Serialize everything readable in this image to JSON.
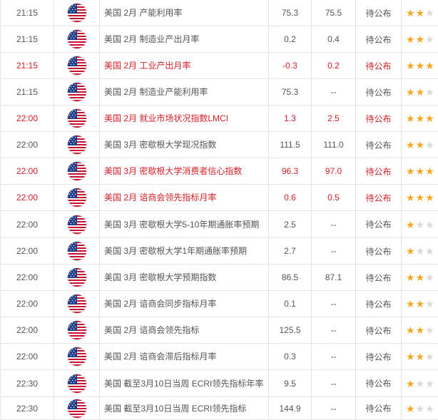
{
  "rows": [
    {
      "time": "21:15",
      "title": "美国 2月 产能利用率",
      "prev": "75.3",
      "forecast": "75.5",
      "actual": "待公布",
      "stars": 2,
      "highlight": false,
      "height": 37
    },
    {
      "time": "21:15",
      "title": "美国 2月 制造业产出月率",
      "prev": "0.2",
      "forecast": "0.4",
      "actual": "待公布",
      "stars": 2,
      "highlight": false,
      "height": 37
    },
    {
      "time": "21:15",
      "title": "美国 2月 工业产出月率",
      "prev": "-0.3",
      "forecast": "0.2",
      "actual": "待公布",
      "stars": 3,
      "highlight": true,
      "height": 37
    },
    {
      "time": "21:15",
      "title": "美国 2月 制造业产能利用率",
      "prev": "75.3",
      "forecast": "--",
      "actual": "待公布",
      "stars": 2,
      "highlight": false,
      "height": 37
    },
    {
      "time": "22:00",
      "title": "美国 2月 就业市场状况指数LMCI",
      "prev": "1.3",
      "forecast": "2.5",
      "actual": "待公布",
      "stars": 3,
      "highlight": true,
      "height": 37
    },
    {
      "time": "22:00",
      "title": "美国 3月 密歇根大学现况指数",
      "prev": "111.5",
      "forecast": "111.0",
      "actual": "待公布",
      "stars": 2,
      "highlight": false,
      "height": 37
    },
    {
      "time": "22:00",
      "title": "美国 3月 密歇根大学消费者信心指数",
      "prev": "96.3",
      "forecast": "97.0",
      "actual": "待公布",
      "stars": 3,
      "highlight": true,
      "height": 37
    },
    {
      "time": "22:00",
      "title": "美国 2月 谘商会领先指标月率",
      "prev": "0.6",
      "forecast": "0.5",
      "actual": "待公布",
      "stars": 3,
      "highlight": true,
      "height": 37
    },
    {
      "time": "22:00",
      "title": "美国 3月 密歇根大学5-10年期通胀率预期",
      "prev": "2.5",
      "forecast": "--",
      "actual": "待公布",
      "stars": 1,
      "highlight": false,
      "height": 38
    },
    {
      "time": "22:00",
      "title": "美国 3月 密歇根大学1年期通胀率预期",
      "prev": "2.7",
      "forecast": "--",
      "actual": "待公布",
      "stars": 1,
      "highlight": false,
      "height": 37
    },
    {
      "time": "22:00",
      "title": "美国 3月 密歇根大学预期指数",
      "prev": "86.5",
      "forecast": "87.1",
      "actual": "待公布",
      "stars": 2,
      "highlight": false,
      "height": 37
    },
    {
      "time": "22:00",
      "title": "美国 2月 谘商会同步指标月率",
      "prev": "0.1",
      "forecast": "--",
      "actual": "待公布",
      "stars": 2,
      "highlight": false,
      "height": 37
    },
    {
      "time": "22:00",
      "title": "美国 2月 谘商会领先指标",
      "prev": "125.5",
      "forecast": "--",
      "actual": "待公布",
      "stars": 2,
      "highlight": false,
      "height": 37
    },
    {
      "time": "22:00",
      "title": "美国 2月 谘商会滞后指标月率",
      "prev": "0.3",
      "forecast": "--",
      "actual": "待公布",
      "stars": 2,
      "highlight": false,
      "height": 37
    },
    {
      "time": "22:30",
      "title": "美国 截至3月10日当周 ECRI领先指标年率",
      "prev": "9.5",
      "forecast": "--",
      "actual": "待公布",
      "stars": 1,
      "highlight": false,
      "height": 38
    },
    {
      "time": "22:30",
      "title": "美国 截至3月10日当周 ECRI领先指标",
      "prev": "144.9",
      "forecast": "--",
      "actual": "待公布",
      "stars": 1,
      "highlight": false,
      "height": 32
    }
  ],
  "colors": {
    "highlight": "#d41f26",
    "normal": "#555555",
    "star_on": "#f5a623",
    "star_off": "#d9d9d9"
  },
  "icon": "us-flag-icon"
}
